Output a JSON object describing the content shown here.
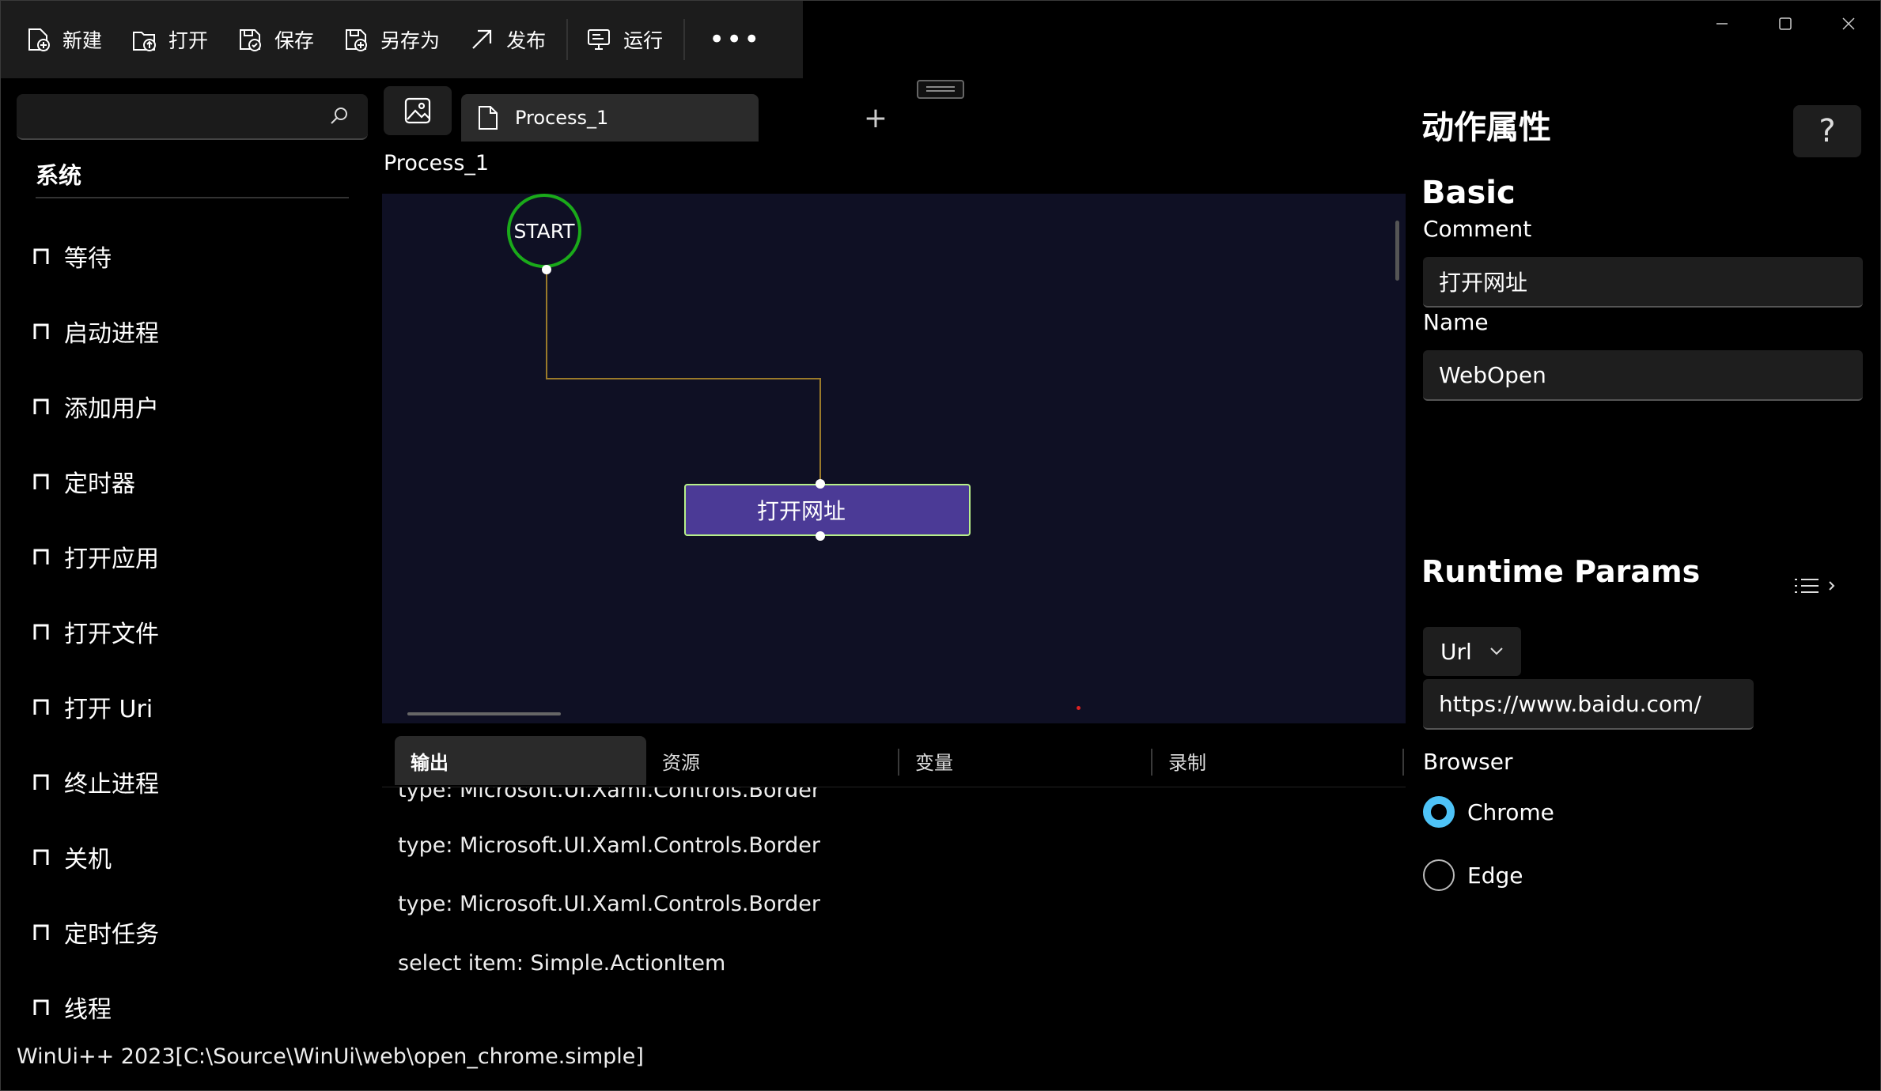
{
  "toolbar": {
    "new_label": "新建",
    "open_label": "打开",
    "save_label": "保存",
    "save_as_label": "另存为",
    "publish_label": "发布",
    "run_label": "运行",
    "more_label": "•••"
  },
  "sidebar": {
    "search_placeholder": "",
    "section_title": "系统",
    "items": [
      {
        "label": "等待"
      },
      {
        "label": "启动进程"
      },
      {
        "label": "添加用户"
      },
      {
        "label": "定时器"
      },
      {
        "label": "打开应用"
      },
      {
        "label": "打开文件"
      },
      {
        "label": "打开 Uri"
      },
      {
        "label": "终止进程"
      },
      {
        "label": "关机"
      },
      {
        "label": "定时任务"
      },
      {
        "label": "线程"
      }
    ]
  },
  "editor": {
    "tab_label": "Process_1",
    "add_tab_label": "+",
    "process_title": "Process_1",
    "start_label": "START",
    "action_label": "打开网址"
  },
  "output": {
    "tabs": [
      {
        "label": "输出",
        "active": true
      },
      {
        "label": "资源",
        "active": false
      },
      {
        "label": "变量",
        "active": false
      },
      {
        "label": "录制",
        "active": false
      }
    ],
    "lines": [
      "type: Microsoft.UI.Xaml.Controls.Border",
      "type: Microsoft.UI.Xaml.Controls.Border",
      "type: Microsoft.UI.Xaml.Controls.Border",
      "select item: Simple.ActionItem"
    ]
  },
  "properties": {
    "title": "动作属性",
    "help_label": "?",
    "basic_heading": "Basic",
    "comment_label": "Comment",
    "comment_value": "打开网址",
    "name_label": "Name",
    "name_value": "WebOpen",
    "runtime_heading": "Runtime Params",
    "param_select": "Url",
    "url_value": "https://www.baidu.com/",
    "browser_label": "Browser",
    "browser_options": [
      {
        "label": "Chrome",
        "selected": true
      },
      {
        "label": "Edge",
        "selected": false
      }
    ]
  },
  "status_bar": {
    "text": "WinUi++ 2023[C:\\Source\\WinUi\\web\\open_chrome.simple]"
  },
  "colors": {
    "canvas_bg": "#0f1024",
    "start_border": "#1aaa1a",
    "action_fill": "#4b3a96",
    "action_border": "#b8f08a",
    "connector": "#9a7a2a",
    "radio_selected": "#4ec3f7"
  }
}
